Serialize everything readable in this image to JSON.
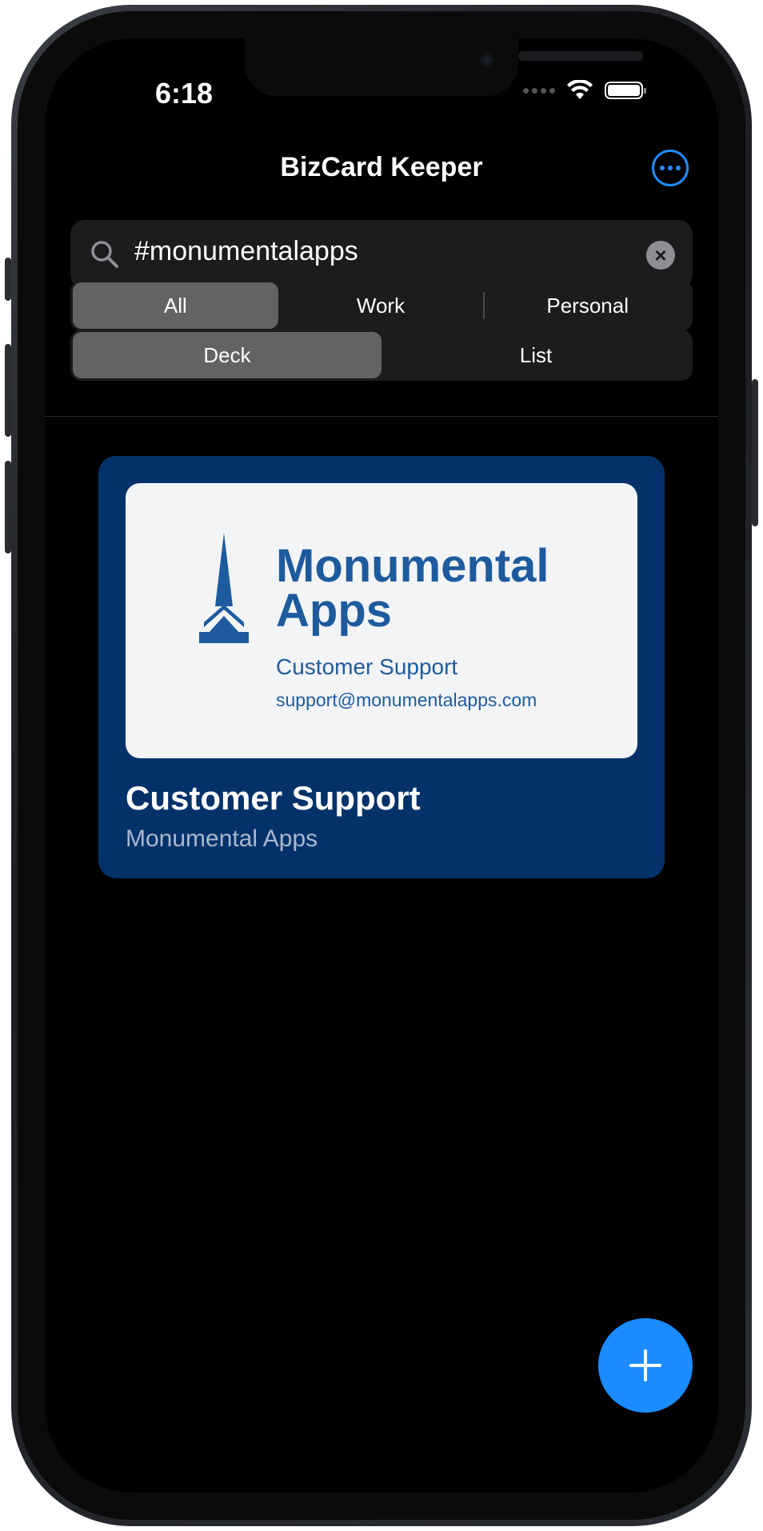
{
  "status_bar": {
    "time": "6:18"
  },
  "nav": {
    "title": "BizCard Keeper",
    "more_icon": "ellipsis-circle-icon"
  },
  "search": {
    "value": "#monumentalapps",
    "placeholder": "Search"
  },
  "filter_segment": {
    "items": [
      {
        "label": "All"
      },
      {
        "label": "Work"
      },
      {
        "label": "Personal"
      }
    ],
    "selected": "All"
  },
  "view_segment": {
    "items": [
      {
        "label": "Deck"
      },
      {
        "label": "List"
      }
    ],
    "selected": "Deck"
  },
  "card": {
    "image": {
      "brand_line1": "Monumental",
      "brand_line2": "Apps",
      "department": "Customer Support",
      "email": "support@monumentalapps.com",
      "logo_icon": "spire-logo-icon"
    },
    "name": "Customer Support",
    "company": "Monumental Apps"
  },
  "fab": {
    "icon": "plus-icon"
  },
  "colors": {
    "accent": "#1e8cff",
    "card_background": "#03326a",
    "brand_blue": "#1e5b9e"
  }
}
